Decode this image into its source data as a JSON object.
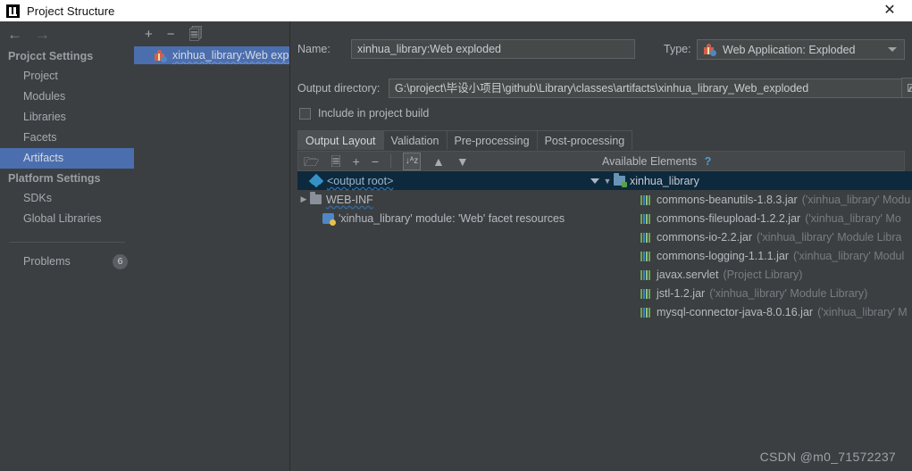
{
  "window": {
    "title": "Project Structure",
    "logo_icon": "intellij-idea-logo",
    "close_icon": "close-icon"
  },
  "sidebar": {
    "back_icon": "arrow-left-icon",
    "forward_icon": "arrow-right-icon",
    "groups": [
      {
        "label": "Projcct Settings",
        "items": [
          {
            "label": "Project",
            "selected": false
          },
          {
            "label": "Modules",
            "selected": false
          },
          {
            "label": "Libraries",
            "selected": false
          },
          {
            "label": "Facets",
            "selected": false
          },
          {
            "label": "Artifacts",
            "selected": true
          }
        ]
      },
      {
        "label": "Platform Settings",
        "items": [
          {
            "label": "SDKs",
            "selected": false
          },
          {
            "label": "Global Libraries",
            "selected": false
          }
        ]
      }
    ],
    "problems": {
      "label": "Problems",
      "count": "6"
    },
    "selected_color": "#4b6eaf"
  },
  "artifacts_panel": {
    "toolbar": {
      "add_icon": "plus-icon",
      "remove_icon": "minus-icon",
      "copy_icon": "copy-icon"
    },
    "items": [
      {
        "label": "xinhua_library:Web exp",
        "icon": "artifact-icon",
        "selected": true
      }
    ]
  },
  "main": {
    "name_label": "Name:",
    "name_value": "xinhua_library:Web exploded",
    "type_label": "Type:",
    "type_value": "Web Application: Exploded",
    "type_icon": "artifact-icon",
    "type_caret_icon": "chevron-down-icon",
    "output_dir_label": "Output directory:",
    "output_dir_value": "G:\\project\\毕设小项目\\github\\Library\\classes\\artifacts\\xinhua_library_Web_exploded",
    "browse_icon": "folder-open-icon",
    "include_in_build_label": "Include in project build",
    "include_in_build_checked": false,
    "tabs": [
      {
        "label": "Output Layout",
        "selected": true
      },
      {
        "label": "Validation",
        "selected": false
      },
      {
        "label": "Pre-processing",
        "selected": false
      },
      {
        "label": "Post-processing",
        "selected": false
      }
    ],
    "layout_toolbar": {
      "add_dir_icon": "new-folder-icon",
      "add_archive_icon": "new-archive-icon",
      "add_icon": "plus-dropdown-icon",
      "remove_icon": "minus-icon",
      "sort_icon": "sort-az-icon",
      "up_icon": "arrow-up-icon",
      "down_icon": "arrow-down-icon"
    },
    "available_elements_label": "Available Elements",
    "available_help_icon": "help-question-icon",
    "output_tree": [
      {
        "label": "<output root>",
        "icon": "output-root-icon",
        "indent": 0,
        "selected": true,
        "expander": "",
        "wavy": true
      },
      {
        "label": "WEB-INF",
        "icon": "folder-icon",
        "indent": 0,
        "selected": false,
        "expander": "collapsed",
        "wavy": true
      },
      {
        "label": "'xinhua_library' module: 'Web' facet resources",
        "icon": "facet-icon",
        "indent": 1,
        "selected": false,
        "expander": "",
        "wavy": false
      }
    ],
    "available_tree": {
      "root": {
        "label": "xinhua_library",
        "icon": "module-icon",
        "expander": "expanded",
        "selected": true
      },
      "children": [
        {
          "name": "commons-beanutils-1.8.3.jar",
          "source": "('xinhua_library' Modu",
          "icon": "jar-icon"
        },
        {
          "name": "commons-fileupload-1.2.2.jar",
          "source": "('xinhua_library' Mo",
          "icon": "jar-icon"
        },
        {
          "name": "commons-io-2.2.jar",
          "source": "('xinhua_library' Module Libra",
          "icon": "jar-icon"
        },
        {
          "name": "commons-logging-1.1.1.jar",
          "source": "('xinhua_library' Modul",
          "icon": "jar-icon"
        },
        {
          "name": "javax.servlet",
          "source": "(Project Library)",
          "icon": "jar-icon"
        },
        {
          "name": "jstl-1.2.jar",
          "source": "('xinhua_library' Module Library)",
          "icon": "jar-icon"
        },
        {
          "name": "mysql-connector-java-8.0.16.jar",
          "source": "('xinhua_library' M",
          "icon": "jar-icon"
        }
      ]
    }
  },
  "watermark": "CSDN @m0_71572237",
  "colors": {
    "background": "#3c3f41",
    "selection_blue": "#4b6eaf",
    "tree_selection": "#0d293e",
    "accent_link": "#4e9dd4"
  }
}
